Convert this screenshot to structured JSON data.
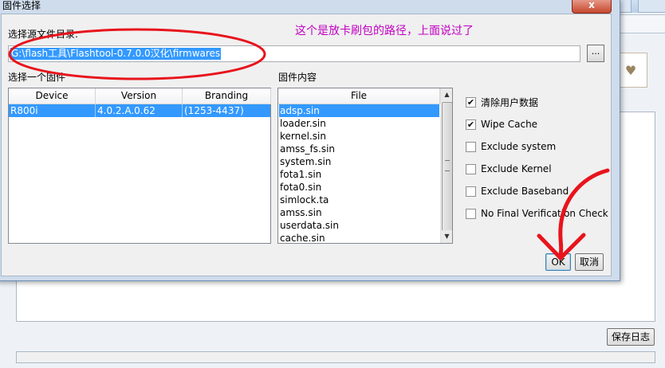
{
  "dialog": {
    "title": "固件选择",
    "source_dir_label": "选择源文件目录:",
    "source_dir_value": "G:\\flash工具\\Flashtool-0.7.0.0汉化\\firmwares",
    "browse_label": "...",
    "select_firmware_label": "选择一个固件",
    "firmware_contents_label": "固件内容",
    "device_table": {
      "columns": [
        "Device",
        "Version",
        "Branding"
      ],
      "rows": [
        {
          "device": "R800i",
          "version": "4.0.2.A.0.62",
          "branding": "(1253-4437)",
          "selected": true
        }
      ]
    },
    "files": {
      "header": "File",
      "items": [
        "adsp.sin",
        "loader.sin",
        "kernel.sin",
        "amss_fs.sin",
        "system.sin",
        "fota1.sin",
        "fota0.sin",
        "simlock.ta",
        "amss.sin",
        "userdata.sin",
        "cache.sin"
      ],
      "selected_index": 0
    },
    "options": [
      {
        "label": "清除用户数据",
        "checked": true
      },
      {
        "label": "Wipe Cache",
        "checked": true
      },
      {
        "label": "Exclude system",
        "checked": false
      },
      {
        "label": "Exclude Kernel",
        "checked": false
      },
      {
        "label": "Exclude Baseband",
        "checked": false
      },
      {
        "label": "No Final Verification Check",
        "checked": false
      }
    ],
    "ok_label": "OK",
    "cancel_label": "取消",
    "close_label": "x"
  },
  "annotation_text": "这个是放卡刷包的路径，上面说过了",
  "background": {
    "save_log_label": "保存日志",
    "toolbar_icon": "heart-icon"
  },
  "colors": {
    "selection": "#3399ff",
    "annotation": "#c200c2",
    "marker": "#e8141c"
  }
}
